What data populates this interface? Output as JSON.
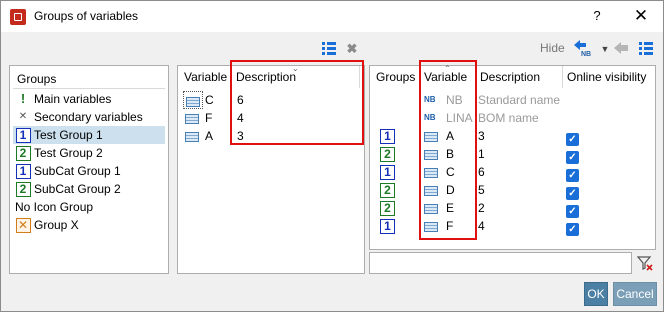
{
  "window": {
    "title": "Groups of variables",
    "help": "?",
    "close": "✕"
  },
  "toolbar": {
    "mid_icons": [
      "list-icon",
      "delete-icon"
    ],
    "right": {
      "hide": "Hide",
      "nb_sub": "NB",
      "icons": [
        "nb-arrow-icon",
        "dropdown-arrow-icon",
        "left-arrow-icon",
        "list-icon"
      ]
    }
  },
  "groups": {
    "header": "Groups",
    "items": [
      {
        "label": "Main variables",
        "icon": "exclamation-icon"
      },
      {
        "label": "Secondary variables",
        "icon": "x-small-icon"
      },
      {
        "label": "Test Group 1",
        "icon": "badge-1-icon",
        "selected": true
      },
      {
        "label": "Test Group 2",
        "icon": "badge-2-icon"
      },
      {
        "label": "SubCat Group 1",
        "icon": "badge-1-icon"
      },
      {
        "label": "SubCat Group 2",
        "icon": "badge-2-icon"
      },
      {
        "label": "No Icon Group",
        "icon": ""
      },
      {
        "label": "Group X",
        "icon": "badge-x-icon"
      }
    ]
  },
  "middle_table": {
    "headers": {
      "variable": "Variable",
      "description": "Description"
    },
    "rows": [
      {
        "variable": "C",
        "description": "6"
      },
      {
        "variable": "F",
        "description": "4"
      },
      {
        "variable": "A",
        "description": "3"
      }
    ]
  },
  "right_table": {
    "headers": {
      "groups": "Groups",
      "variable": "Variable",
      "description": "Description",
      "online": "Online visibility"
    },
    "rows": [
      {
        "group": "",
        "var_icon": "NB",
        "variable": "NB",
        "description": "Standard name",
        "checked": false,
        "greyed": true
      },
      {
        "group": "",
        "var_icon": "NB",
        "variable": "LINA",
        "description": "BOM name",
        "checked": false,
        "greyed": true
      },
      {
        "group": "1",
        "var_icon": "var",
        "variable": "A",
        "description": "3",
        "checked": true,
        "greyed": false
      },
      {
        "group": "2",
        "var_icon": "var",
        "variable": "B",
        "description": "1",
        "checked": true,
        "greyed": false
      },
      {
        "group": "1",
        "var_icon": "var",
        "variable": "C",
        "description": "6",
        "checked": true,
        "greyed": false
      },
      {
        "group": "2",
        "var_icon": "var",
        "variable": "D",
        "description": "5",
        "checked": true,
        "greyed": false
      },
      {
        "group": "2",
        "var_icon": "var",
        "variable": "E",
        "description": "2",
        "checked": true,
        "greyed": false
      },
      {
        "group": "1",
        "var_icon": "var",
        "variable": "F",
        "description": "4",
        "checked": true,
        "greyed": false
      }
    ]
  },
  "filter": {
    "value": ""
  },
  "buttons": {
    "ok": "OK",
    "cancel": "Cancel"
  }
}
